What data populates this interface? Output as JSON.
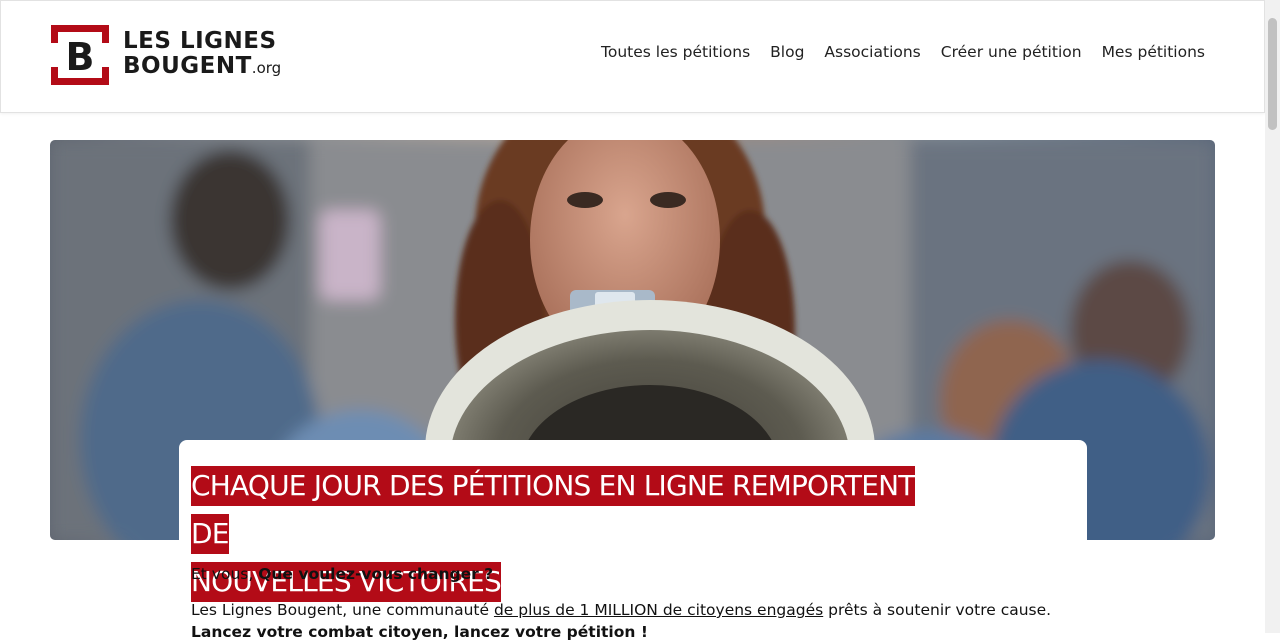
{
  "logo": {
    "line1": "LES LIGNES",
    "line2": "BOUGENT",
    "suffix": ".org",
    "mark_letter": "B",
    "brand_color": "#b30b17"
  },
  "nav": {
    "items": [
      {
        "label": "Toutes les pétitions"
      },
      {
        "label": "Blog"
      },
      {
        "label": "Associations"
      },
      {
        "label": "Créer une pétition"
      },
      {
        "label": "Mes pétitions"
      }
    ]
  },
  "hero": {
    "image_icon": "hero-photo-protester-megaphone",
    "headline_line1": "CHAQUE JOUR DES PÉTITIONS EN LIGNE REMPORTENT DE",
    "headline_line2": "NOUVELLES VICTOIRES",
    "headline_bg": "#b30b17"
  },
  "intro": {
    "prefix": "Et vous, ",
    "question": "Que voulez-vous changer ?"
  },
  "description": {
    "prefix": "Les Lignes Bougent, une communauté ",
    "link": "de plus de 1 MILLION de citoyens engagés",
    "suffix": " prêts à soutenir votre cause.",
    "cta": "Lancez votre combat citoyen, lancez votre pétition !"
  }
}
